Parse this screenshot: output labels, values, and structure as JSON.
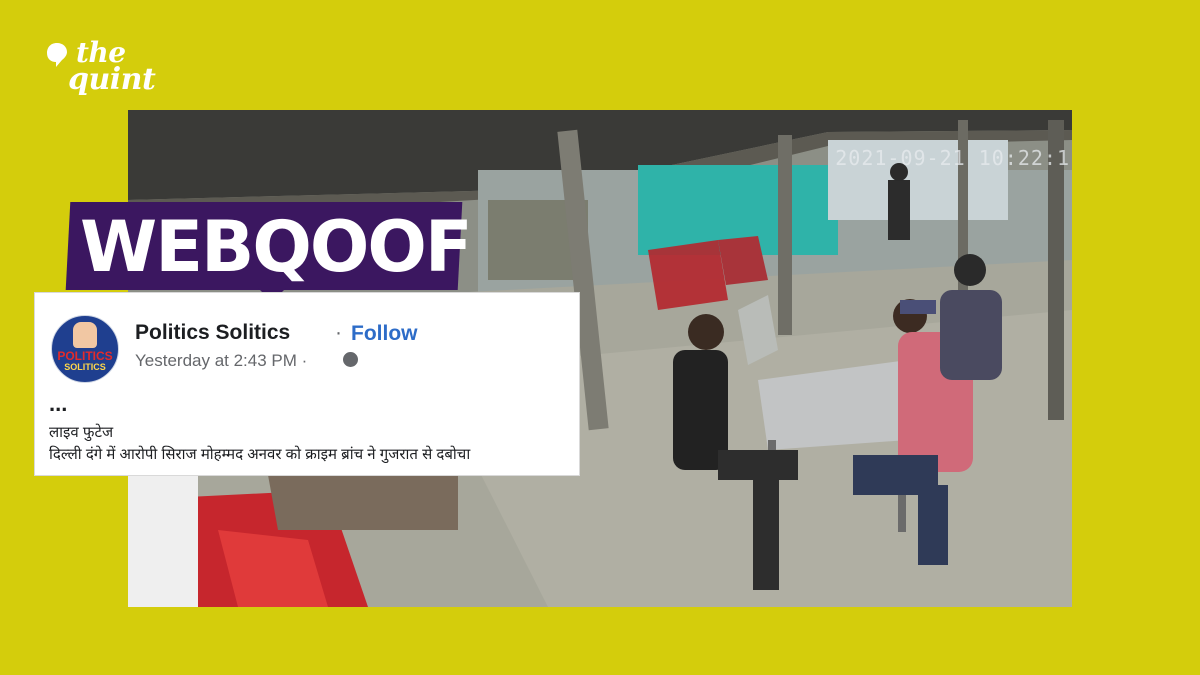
{
  "brand": {
    "logo_top": "the",
    "logo_bottom": "quint"
  },
  "label": {
    "text": "WEBQOOF"
  },
  "video": {
    "timestamp": "2021-09-21 10:22:1"
  },
  "post": {
    "page_name": "Politics Solitics",
    "separator": "·",
    "follow_label": "Follow",
    "time": "Yesterday at 2:43 PM ·",
    "privacy_icon": "globe-icon",
    "avatar_text_1": "POLITICS",
    "avatar_text_2": "SOLITICS",
    "ellipsis": "...",
    "text_line_1": "लाइव फुटेज",
    "text_line_2": "दिल्ली दंगे में आरोपी सिराज मोहम्मद अनवर को क्राइम ब्रांच ने गुजरात से दबोचा"
  },
  "colors": {
    "background": "#d4cd0c",
    "label_bg": "#3b1760",
    "follow": "#2d6cc8"
  }
}
